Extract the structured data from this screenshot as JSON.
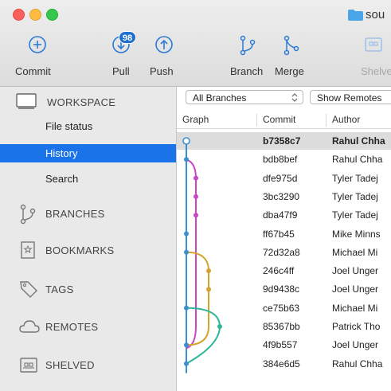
{
  "window": {
    "title": "sou"
  },
  "toolbar": {
    "commit": "Commit",
    "pull": "Pull",
    "pull_badge": "98",
    "push": "Push",
    "branch": "Branch",
    "merge": "Merge",
    "shelve": "Shelve"
  },
  "sidebar": {
    "workspace": "WORKSPACE",
    "file_status": "File status",
    "history": "History",
    "search": "Search",
    "branches": "BRANCHES",
    "bookmarks": "BOOKMARKS",
    "tags": "TAGS",
    "remotes": "REMOTES",
    "shelved": "SHELVED"
  },
  "filters": {
    "branches": "All Branches",
    "remotes": "Show Remotes"
  },
  "columns": {
    "graph": "Graph",
    "commit": "Commit",
    "author": "Author"
  },
  "commits": [
    {
      "hash": "b7358c7",
      "author": "Rahul Chha"
    },
    {
      "hash": "bdb8bef",
      "author": "Rahul Chha"
    },
    {
      "hash": "dfe975d",
      "author": "Tyler Tadej"
    },
    {
      "hash": "3bc3290",
      "author": "Tyler Tadej"
    },
    {
      "hash": "dba47f9",
      "author": "Tyler Tadej"
    },
    {
      "hash": "ff67b45",
      "author": "Mike Minns"
    },
    {
      "hash": "72d32a8",
      "author": "Michael Mi"
    },
    {
      "hash": "246c4ff",
      "author": "Joel Unger"
    },
    {
      "hash": "9d9438c",
      "author": "Joel Unger"
    },
    {
      "hash": "ce75b63",
      "author": "Michael Mi"
    },
    {
      "hash": "85367bb",
      "author": "Patrick Tho"
    },
    {
      "hash": "4f9b557",
      "author": "Joel Unger"
    },
    {
      "hash": "384e6d5",
      "author": "Rahul Chha"
    }
  ],
  "colors": {
    "accent": "#1a73e8",
    "blue_lane": "#3a8fd0",
    "magenta_lane": "#c844c8",
    "gold_lane": "#d4a22e",
    "green_lane": "#2fb59a"
  }
}
